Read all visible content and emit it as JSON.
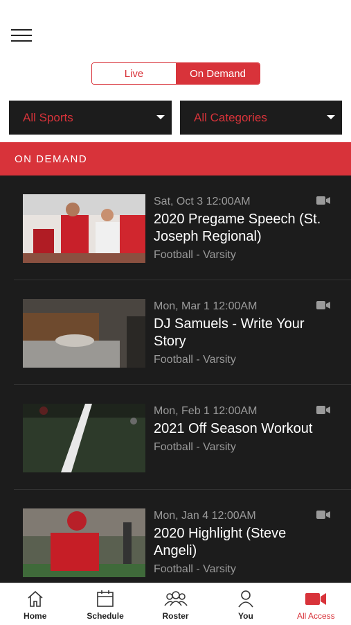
{
  "segment": {
    "live_label": "Live",
    "ondemand_label": "On Demand"
  },
  "filters": {
    "sports": "All Sports",
    "categories": "All Categories"
  },
  "section_title": "ON DEMAND",
  "items": [
    {
      "date": "Sat, Oct 3 12:00AM",
      "title": "2020 Pregame Speech (St. Joseph Regional)",
      "sub": "Football - Varsity"
    },
    {
      "date": "Mon, Mar 1 12:00AM",
      "title": "DJ Samuels - Write Your Story",
      "sub": "Football - Varsity"
    },
    {
      "date": "Mon, Feb 1 12:00AM",
      "title": "2021 Off Season Workout",
      "sub": "Football - Varsity"
    },
    {
      "date": "Mon, Jan 4 12:00AM",
      "title": "2020 Highlight (Steve Angeli)",
      "sub": "Football - Varsity"
    }
  ],
  "tabs": [
    {
      "label": "Home",
      "icon": "home-icon"
    },
    {
      "label": "Schedule",
      "icon": "calendar-icon"
    },
    {
      "label": "Roster",
      "icon": "roster-icon"
    },
    {
      "label": "You",
      "icon": "user-icon"
    },
    {
      "label": "All Access",
      "icon": "video-camera-icon",
      "active": true
    }
  ],
  "colors": {
    "accent": "#d8333a",
    "dark": "#1c1c1c"
  }
}
